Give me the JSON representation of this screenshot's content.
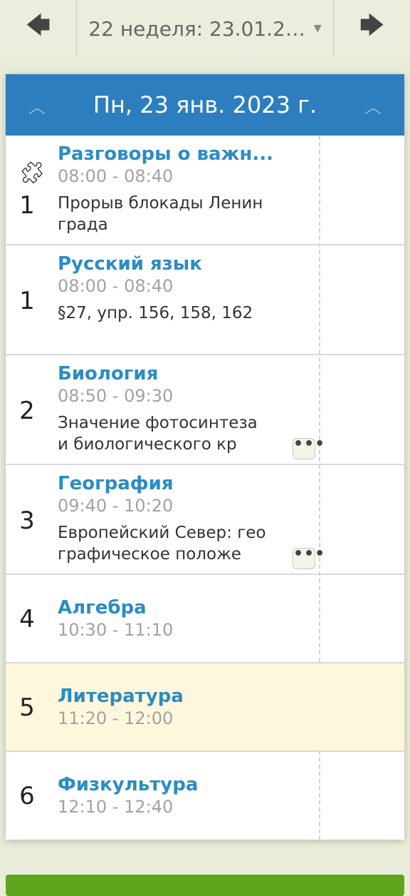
{
  "nav": {
    "prev_icon": "arrow-left-icon",
    "next_icon": "arrow-right-icon",
    "week_label": "22 неделя: 23.01.2…"
  },
  "day": {
    "title": "Пн, 23 янв. 2023 г."
  },
  "colors": {
    "header_bg": "#2d7ebf",
    "subject": "#2c8cc2",
    "current_row": "#fdf8dc",
    "bottom_button": "#5fa61e"
  },
  "lessons": [
    {
      "number": "1",
      "subject": "Разговоры о важн...",
      "time": "08:00 - 08:40",
      "homework": "Прорыв блокады Ленинграда",
      "icon": "puzzle-icon",
      "has_more": false
    },
    {
      "number": "1",
      "subject": "Русский язык",
      "time": "08:00 - 08:40",
      "homework": "§27, упр. 156, 158, 162",
      "has_more": false
    },
    {
      "number": "2",
      "subject": "Биология",
      "time": "08:50 - 09:30",
      "homework": "Значение фотосинтеза и биологического кр",
      "has_more": true
    },
    {
      "number": "3",
      "subject": "География",
      "time": "09:40 - 10:20",
      "homework": "Европейский Север: географическое положе",
      "has_more": true
    },
    {
      "number": "4",
      "subject": "Алгебра",
      "time": "10:30 - 11:10"
    },
    {
      "number": "5",
      "subject": "Литература",
      "time": "11:20 - 12:00",
      "current": true
    },
    {
      "number": "6",
      "subject": "Физкультура",
      "time": "12:10 - 12:40"
    }
  ],
  "more_label": "•••"
}
